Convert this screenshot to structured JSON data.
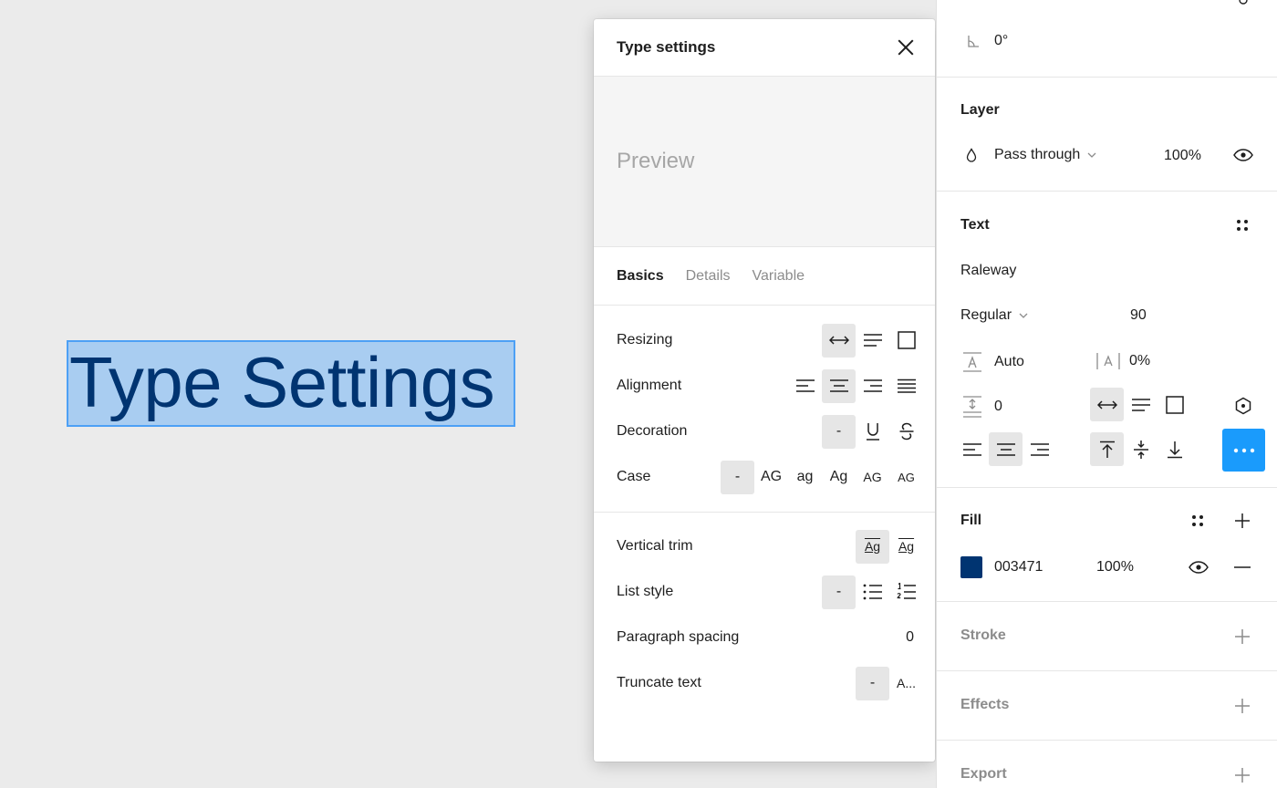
{
  "canvas": {
    "selected_text": "Type Settings"
  },
  "popover": {
    "title": "Type settings",
    "preview_text": "Preview",
    "tabs": [
      {
        "label": "Basics"
      },
      {
        "label": "Details"
      },
      {
        "label": "Variable"
      }
    ],
    "rows": {
      "resizing": "Resizing",
      "alignment": "Alignment",
      "decoration": "Decoration",
      "case": "Case",
      "vertical_trim": "Vertical trim",
      "list_style": "List style",
      "paragraph_spacing": "Paragraph spacing",
      "truncate_text": "Truncate text"
    },
    "options": {
      "dash": "-",
      "case_upper": "AG",
      "case_lower": "ag",
      "case_title": "Ag",
      "case_small_caps": "AG",
      "case_forced_small_caps": "AG",
      "trim_standard": "Ag",
      "trim_cap": "Ag",
      "truncate_ellipsis": "A..."
    },
    "paragraph_spacing_value": "0"
  },
  "panel": {
    "rotation_value": "0°",
    "layer": {
      "title": "Layer",
      "blend_mode": "Pass through",
      "opacity": "100%"
    },
    "text": {
      "title": "Text",
      "font_family": "Raleway",
      "font_weight": "Regular",
      "font_size": "90",
      "line_height": "Auto",
      "letter_spacing": "0%",
      "paragraph_spacing": "0"
    },
    "fill": {
      "title": "Fill",
      "hex": "003471",
      "opacity": "100%",
      "color": "#003471"
    },
    "stroke": {
      "title": "Stroke"
    },
    "effects": {
      "title": "Effects"
    },
    "export": {
      "title": "Export"
    }
  },
  "colors": {
    "accent": "#1a9bfc",
    "selection": "#a9cdf1",
    "text_fill": "#003471"
  }
}
